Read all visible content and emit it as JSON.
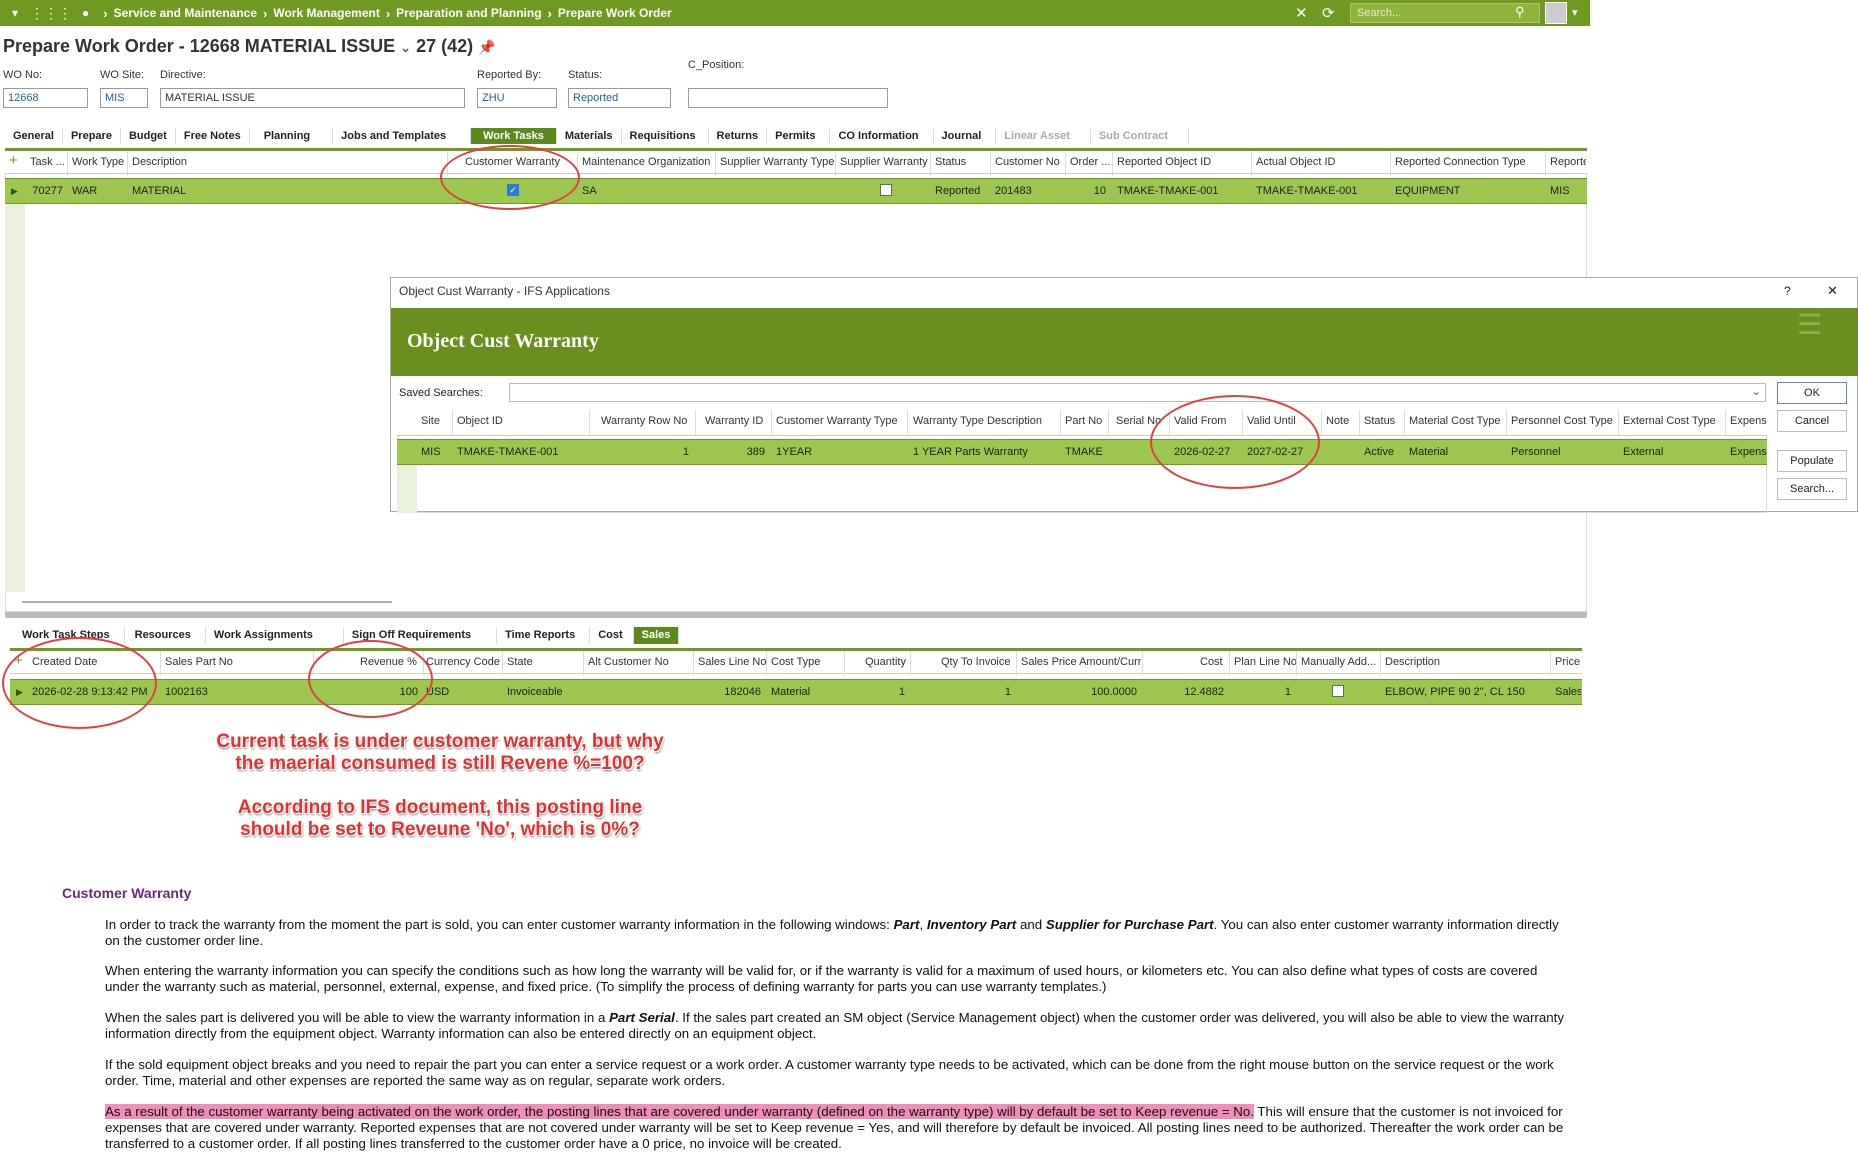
{
  "nav": {
    "breadcrumbs": [
      "Service and Maintenance",
      "Work Management",
      "Preparation and Planning",
      "Prepare Work Order"
    ],
    "search_placeholder": "Search..."
  },
  "page": {
    "title": "Prepare Work Order - 12668 MATERIAL ISSUE",
    "record_counter": "27 (42)"
  },
  "header_fields": {
    "wo_no": {
      "label": "WO No:",
      "value": "12668"
    },
    "wo_site": {
      "label": "WO Site:",
      "value": "MIS"
    },
    "directive": {
      "label": "Directive:",
      "value": "MATERIAL ISSUE"
    },
    "reported_by": {
      "label": "Reported By:",
      "value": "ZHU"
    },
    "status": {
      "label": "Status:",
      "value": "Reported"
    },
    "c_position": {
      "label": "C_Position:",
      "value": ""
    }
  },
  "main_tabs": [
    "General",
    "Prepare",
    "Budget",
    "Free Notes",
    "Planning",
    "Jobs and Templates",
    "Work Tasks",
    "Materials",
    "Requisitions",
    "Returns",
    "Permits",
    "CO Information",
    "Journal",
    "Linear Asset",
    "Sub Contract"
  ],
  "main_tab_active": "Work Tasks",
  "task_grid": {
    "columns": [
      "Task ...",
      "Work Type",
      "Description",
      "Customer Warranty",
      "Maintenance Organization",
      "Supplier Warranty Type",
      "Supplier Warranty",
      "Status",
      "Customer No",
      "Order ...",
      "Reported Object ID",
      "Actual Object ID",
      "Reported Connection Type",
      "Reporte"
    ],
    "row": {
      "task": "70277",
      "work_type": "WAR",
      "description": "MATERIAL",
      "maint_org": "SA",
      "status": "Reported",
      "customer_no": "201483",
      "order": "10",
      "reported_object": "TMAKE-TMAKE-001",
      "actual_object": "TMAKE-TMAKE-001",
      "connection_type": "EQUIPMENT",
      "reporte": "MIS"
    }
  },
  "dialog": {
    "window_title": "Object Cust Warranty  - IFS Applications",
    "heading": "Object Cust Warranty",
    "saved_searches_label": "Saved Searches:",
    "buttons": {
      "ok": "OK",
      "cancel": "Cancel",
      "populate": "Populate",
      "search": "Search..."
    },
    "help": "?",
    "close": "✕",
    "columns": [
      "Site",
      "Object ID",
      "Warranty Row No",
      "Warranty ID",
      "Customer Warranty Type",
      "Warranty Type Description",
      "Part No",
      "Serial No",
      "Valid From",
      "Valid Until",
      "Note",
      "Status",
      "Material Cost Type",
      "Personnel Cost Type",
      "External Cost Type",
      "Expense"
    ],
    "row": {
      "site": "MIS",
      "object_id": "TMAKE-TMAKE-001",
      "row_no": "1",
      "warranty_id": "389",
      "type": "1YEAR",
      "type_desc": "1 YEAR Parts Warranty",
      "part_no": "TMAKE",
      "serial": "",
      "valid_from": "2026-02-27",
      "valid_until": "2027-02-27",
      "note": "",
      "status": "Active",
      "material": "Material",
      "personnel": "Personnel",
      "external": "External",
      "expense": "Expense"
    }
  },
  "sub_tabs": [
    "Work Task Steps",
    "Resources",
    "Work Assignments",
    "Sign Off Requirements",
    "Time Reports",
    "Cost",
    "Sales"
  ],
  "sub_tab_active": "Sales",
  "sales_grid": {
    "columns": [
      "Created Date",
      "Sales Part No",
      "Revenue %",
      "Currency Code",
      "State",
      "Alt Customer No",
      "Sales Line No",
      "Cost Type",
      "Quantity",
      "Qty To Invoice",
      "Sales Price Amount/Curr",
      "Cost",
      "Plan Line No",
      "Manually Add...",
      "Description",
      "Price"
    ],
    "row": {
      "created": "2026-02-28 9:13:42 PM",
      "part": "1002163",
      "revenue": "100",
      "currency": "USD",
      "state": "Invoiceable",
      "alt_cust": "",
      "line_no": "182046",
      "cost_type": "Material",
      "qty": "1",
      "qty_inv": "1",
      "price": "100.0000",
      "cost": "12.4882",
      "plan_line": "1",
      "description": "ELBOW, PIPE 90 2\", CL 150",
      "price_col": "Sales"
    }
  },
  "annotations": {
    "note1_line1": "Current task is under customer warranty, but why",
    "note1_line2": "the maerial consumed is still Revene %=100?",
    "note2_line1": "According to IFS document, this posting line",
    "note2_line2": "should be set to Reveune 'No', which is 0%?"
  },
  "doc": {
    "heading": "Customer Warranty",
    "p1_a": "In order to track the warranty from the moment the part is sold, you can enter customer warranty information in the following windows: ",
    "p1_b": "Part",
    "p1_c": ", ",
    "p1_d": "Inventory Part",
    "p1_e": " and ",
    "p1_f": "Supplier for Purchase Part",
    "p1_g": ". You can also enter customer warranty information directly on the customer order line.",
    "p2": "When entering the warranty information you can specify the conditions such as how long the warranty will be valid for, or if the warranty is valid for a maximum of used hours, or kilometers etc. You can also define what types of costs are covered under the warranty such as material, personnel, external, expense, and fixed price. (To simplify the process of defining warranty for parts you can use warranty templates.)",
    "p3_a": "When the sales part is delivered you will be able to view the warranty information in a ",
    "p3_b": "Part Serial",
    "p3_c": ". If the sales part created an SM object (Service Management object) when the customer order was delivered, you will also be able to view the warranty information directly from the equipment object. Warranty information can also be entered directly on an equipment object.",
    "p4": "If the sold equipment object breaks and you need to repair the part you can enter a service request or a work order. A customer warranty type needs to be activated, which can be done from the right mouse button on the service request or the work order. Time, material and other expenses are reported the same way as on regular, separate work orders.",
    "p5_hl": "As a result of the customer warranty being activated on the work order, the posting lines that are covered under warranty (defined on the warranty type) will by default be set to Keep revenue = No.",
    "p5_rest": " This will ensure that the customer is not invoiced for expenses that are covered under warranty. Reported expenses that are not covered under warranty will be set to Keep revenue = Yes, and will therefore by default be invoiced. All posting lines need to be authorized. Thereafter the work order can be transferred to a customer order. If all posting lines transferred to the customer order have a 0 price, no invoice will be created."
  }
}
